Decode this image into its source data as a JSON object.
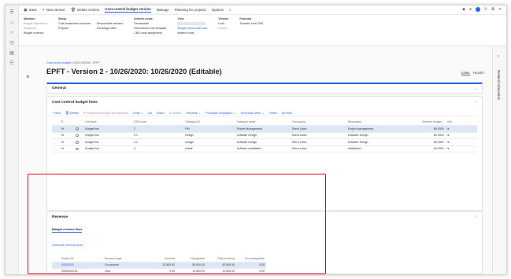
{
  "nav": {
    "icons": [
      "menu-icon",
      "home-icon",
      "star-icon",
      "clock-icon",
      "workspace-icon",
      "list-icon"
    ],
    "glyphs": [
      "☰",
      "⌂",
      "☆",
      "◷",
      "▤",
      "☷"
    ]
  },
  "ribbon": {
    "tabs": [
      {
        "label": "Save",
        "icon": "save-icon",
        "glyph": "▣"
      },
      {
        "label": "New version",
        "icon": "plus-icon",
        "glyph": "+"
      },
      {
        "label": "Delete version",
        "icon": "trash-icon",
        "glyph": "🗑"
      },
      {
        "label": "Cost control budget version",
        "active": true
      },
      {
        "label": "Manage"
      },
      {
        "label": "Planning for projects"
      },
      {
        "label": "Options"
      },
      {
        "label": "",
        "icon": "search-icon",
        "glyph": "⌕"
      }
    ],
    "window_buttons": [
      "◆",
      "●",
      "↻",
      "⧉",
      "✕"
    ],
    "groups": [
      {
        "header": "Maintain",
        "cols": [
          [
            "Budget adjustment",
            "Mutations",
            "Budget revenue"
          ]
        ]
      },
      {
        "header": "Setup",
        "cols": [
          [
            "Cost breakdown structure",
            "Projects"
          ],
          [
            "Responsible workers",
            "Exchange rates"
          ]
        ]
      },
      {
        "header": "Indirect costs",
        "cols": [
          [
            "Recalculate",
            "Edit indirect cost template",
            "CBS code assignment"
          ]
        ]
      },
      {
        "header": "View",
        "cols": [
          [
            "",
            "Budget period split view",
            "Indirect costs"
          ]
        ]
      },
      {
        "header": "Version",
        "cols": [
          [
            "Lock",
            "Unlock"
          ]
        ]
      },
      {
        "header": "Forecast",
        "cols": [
          [
            "Transfer from CBS"
          ]
        ]
      }
    ]
  },
  "breadcrumb": {
    "link": "Cost control budget",
    "rest": "USSI-000006 : EPFT"
  },
  "page_title": "EPFT - Version 2 - 10/26/2020: 10/26/2020 (Editable)",
  "view": {
    "lines": "Lines",
    "header": "Header"
  },
  "general_label": "General",
  "lines_section": {
    "title": "Cost control budget lines",
    "toolbar": [
      {
        "label": "+ New",
        "dim": false
      },
      {
        "label": "🗑 Delete",
        "dim": false
      },
      {
        "label": "⊘ Production budget specification",
        "dim": true
      },
      {
        "label": "Lines ⌄",
        "dim": false
      },
      {
        "label": "Up",
        "dim": false
      },
      {
        "label": "Down",
        "dim": false
      },
      {
        "label": "⊘ Mutate",
        "dim": true
      },
      {
        "label": "Rename ⌄",
        "dim": false
      },
      {
        "label": "Purchase requisition ⌄",
        "dim": false
      },
      {
        "label": "Purchase order ⌄",
        "dim": false
      },
      {
        "label": "Notes",
        "dim": false
      },
      {
        "label": "All lines",
        "dim": false
      }
    ],
    "columns": [
      "",
      "R...",
      "",
      "Line type",
      "CBS code",
      "Category ID",
      "Category name",
      "Cost group",
      "Description",
      "Number budget...",
      "Unit"
    ],
    "rows": [
      {
        "selected": true,
        "r": "Ye",
        "type": "Budget line",
        "cbs": "2",
        "cat": "PM",
        "catname": "Project Management",
        "group": "Direct Labor",
        "desc": "Project management",
        "num": "80.0000",
        "unit": "hr"
      },
      {
        "selected": false,
        "r": "Ye",
        "type": "Budget line",
        "cbs": "3.1",
        "cat": "Design",
        "catname": "Software Design",
        "group": "Direct Labor",
        "desc": "Software Design",
        "num": "80.0000",
        "unit": "hr"
      },
      {
        "selected": false,
        "r": "Ye",
        "type": "Budget line",
        "cbs": "3.2",
        "cat": "Design",
        "catname": "Software Design",
        "group": "Direct Labor",
        "desc": "Software Design",
        "num": "80.0000",
        "unit": "hr"
      },
      {
        "selected": false,
        "r": "Ye",
        "type": "Budget line",
        "cbs": "4",
        "cat": "Install",
        "catname": "Software Installation",
        "group": "Direct Labor",
        "desc": "Installation",
        "num": "80.0000",
        "unit": "hr"
      }
    ]
  },
  "revenue": {
    "title": "Revenue",
    "tab": "Budget revenue lines",
    "generate": "Generate revenue lines",
    "columns": [
      "",
      "Project ID",
      "Revenue type",
      "Invoiced",
      "Chargeable",
      "Total invoicing",
      "Non-chargeable"
    ],
    "rows": [
      {
        "selected": true,
        "project": "00000203",
        "type": "On-account",
        "invoiced": "12,500.00",
        "chargeable": "50,000.00",
        "total": "62,500.00",
        "non": "0.00"
      },
      {
        "selected": false,
        "project": "00000203-01",
        "type": "Hour",
        "invoiced": "0.00",
        "chargeable": "10,500.00",
        "total": "10,500.00",
        "non": "0.00"
      },
      {
        "selected": false,
        "project": "00000203-01",
        "type": "Item",
        "invoiced": "0.00",
        "chargeable": "5,195.00",
        "total": "5,195.00",
        "non": "0.00"
      }
    ]
  },
  "related_info": "Related information",
  "colors": {
    "accent": "#2266e3",
    "highlight": "#e4001b",
    "selected_row": "#dce6f7"
  }
}
